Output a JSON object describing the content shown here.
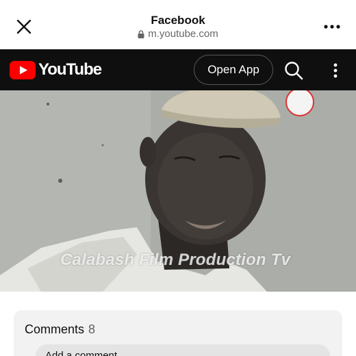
{
  "browser": {
    "title": "Facebook",
    "url": "m.youtube.com",
    "close_icon": "close-icon",
    "lock_icon": "lock-icon",
    "more_icon": "more-horizontal-icon"
  },
  "youtube": {
    "logo_text": "YouTube",
    "open_app_label": "Open App",
    "search_icon": "search-icon",
    "menu_icon": "more-vertical-icon",
    "brand_color": "#ff0000",
    "header_bg": "#0f0f0f"
  },
  "video": {
    "watermark": "Calabash Film Production Tv",
    "channel_badge_icon": "channel-logo-icon"
  },
  "comments": {
    "label": "Comments",
    "count": "8",
    "add_comment_placeholder": "Add a comment..."
  }
}
